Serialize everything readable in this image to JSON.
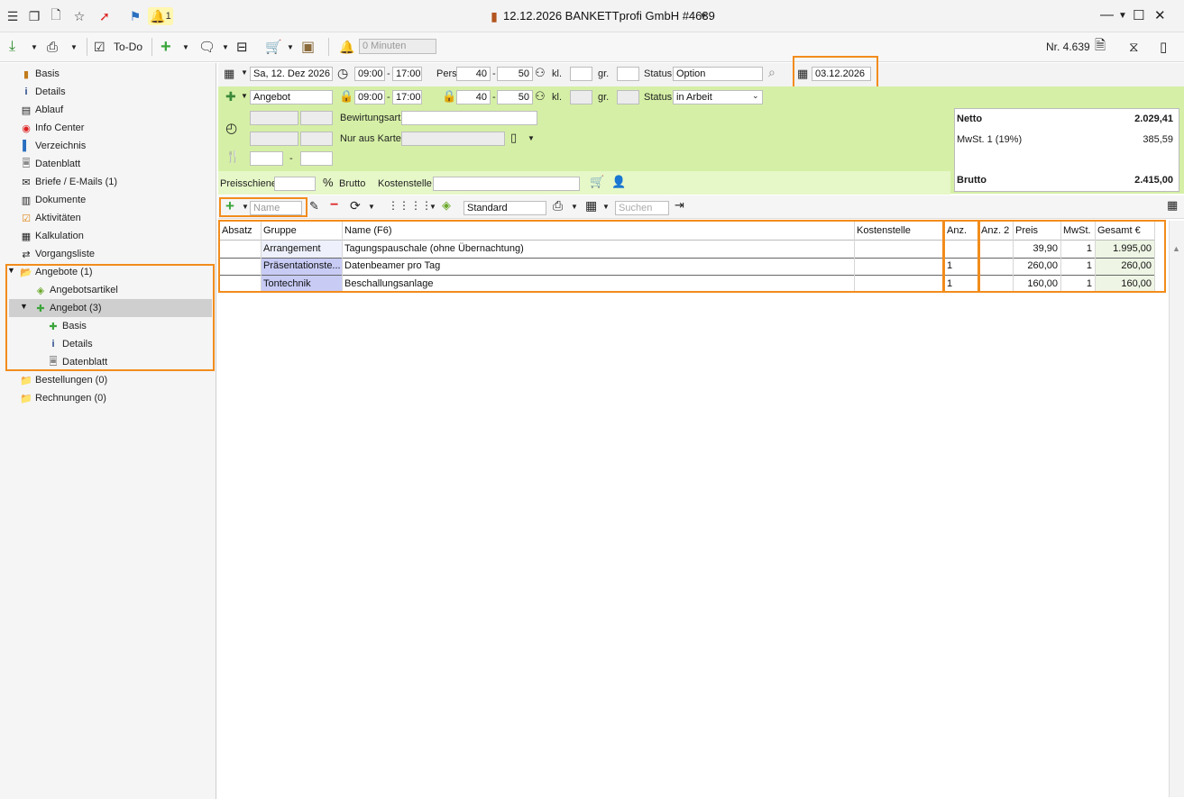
{
  "window": {
    "title": "12.12.2026 BANKETTprofi GmbH #4639",
    "bell_count": "1"
  },
  "toolbar": {
    "todo_label": "To-Do",
    "minutes_placeholder": "0 Minuten",
    "number": "Nr. 4.639"
  },
  "sidebar": {
    "items": [
      {
        "label": "Basis",
        "icon": "basis-icon"
      },
      {
        "label": "Details",
        "icon": "info-icon"
      },
      {
        "label": "Ablauf",
        "icon": "ablauf-icon"
      },
      {
        "label": "Info Center",
        "icon": "compass-icon"
      },
      {
        "label": "Verzeichnis",
        "icon": "book-icon"
      },
      {
        "label": "Datenblatt",
        "icon": "sheet-icon"
      },
      {
        "label": "Briefe / E-Mails (1)",
        "icon": "letters-icon"
      },
      {
        "label": "Dokumente",
        "icon": "documents-icon"
      },
      {
        "label": "Aktivitäten",
        "icon": "checklist-icon"
      },
      {
        "label": "Kalkulation",
        "icon": "calculator-icon"
      },
      {
        "label": "Vorgangsliste",
        "icon": "list-icon"
      },
      {
        "label": "Angebote (1)",
        "icon": "folder-open-icon"
      },
      {
        "label": "Angebotsartikel",
        "icon": "tag-icon"
      },
      {
        "label": "Angebot (3)",
        "icon": "puzzle-icon"
      },
      {
        "label": "Basis",
        "icon": "puzzle-icon"
      },
      {
        "label": "Details",
        "icon": "info-icon"
      },
      {
        "label": "Datenblatt",
        "icon": "sheet-icon"
      },
      {
        "label": "Bestellungen (0)",
        "icon": "folder-icon"
      },
      {
        "label": "Rechnungen (0)",
        "icon": "folder-red-icon"
      }
    ]
  },
  "event_row": {
    "date": "Sa, 12. Dez 2026",
    "time_from": "09:00",
    "time_sep": "-",
    "time_to": "17:00",
    "pers_label": "Pers.",
    "pers_from": "40",
    "pers_to": "50",
    "kl_label": "kl.",
    "gr_label": "gr.",
    "status_label": "Status",
    "status_value": "Option",
    "option_date": "03.12.2026"
  },
  "offer_row": {
    "type": "Angebot",
    "time_from": "09:00",
    "time_sep": "-",
    "time_to": "17:00",
    "pers_from": "40",
    "pers_to": "50",
    "kl_label": "kl.",
    "gr_label": "gr.",
    "status_label": "Status",
    "status_value": "in Arbeit",
    "bewirtungsart_label": "Bewirtungsart",
    "nur_aus_karte_label": "Nur aus Karte",
    "dash": "-"
  },
  "totals": {
    "netto_label": "Netto",
    "netto_value": "2.029,41",
    "mwst_label": "MwSt. 1 (19%)",
    "mwst_value": "385,59",
    "brutto_label": "Brutto",
    "brutto_value": "2.415,00"
  },
  "preis_row": {
    "preisschiene_label": "Preisschiene VK",
    "brutto_label": "Brutto",
    "kostenstelle_label": "Kostenstelle"
  },
  "gridbar": {
    "name_placeholder": "Name",
    "layout_value": "Standard",
    "search_placeholder": "Suchen"
  },
  "table": {
    "headers": [
      "Absatz",
      "Gruppe",
      "Name (F6)",
      "Kostenstelle",
      "Anz.",
      "Anz. 2",
      "Preis",
      "MwSt.",
      "Gesamt €"
    ],
    "rows": [
      {
        "absatz": "",
        "gruppe": "Arrangement",
        "name": "Tagungspauschale (ohne Übernachtung)",
        "kostenstelle": "",
        "anz": "",
        "anz2": "",
        "preis": "39,90",
        "mwst": "1",
        "gesamt": "1.995,00"
      },
      {
        "absatz": "",
        "gruppe": "Präsentationste...",
        "name": "Datenbeamer pro Tag",
        "kostenstelle": "",
        "anz": "1",
        "anz2": "",
        "preis": "260,00",
        "mwst": "1",
        "gesamt": "260,00"
      },
      {
        "absatz": "",
        "gruppe": "Tontechnik",
        "name": "Beschallungsanlage",
        "kostenstelle": "",
        "anz": "1",
        "anz2": "",
        "preis": "160,00",
        "mwst": "1",
        "gesamt": "160,00"
      }
    ]
  },
  "colors": {
    "accent_orange": "#f28c1c",
    "green_panel": "#d5f0a6",
    "group_highlight": "#c8ccf5",
    "add_green": "#3aa53a"
  }
}
